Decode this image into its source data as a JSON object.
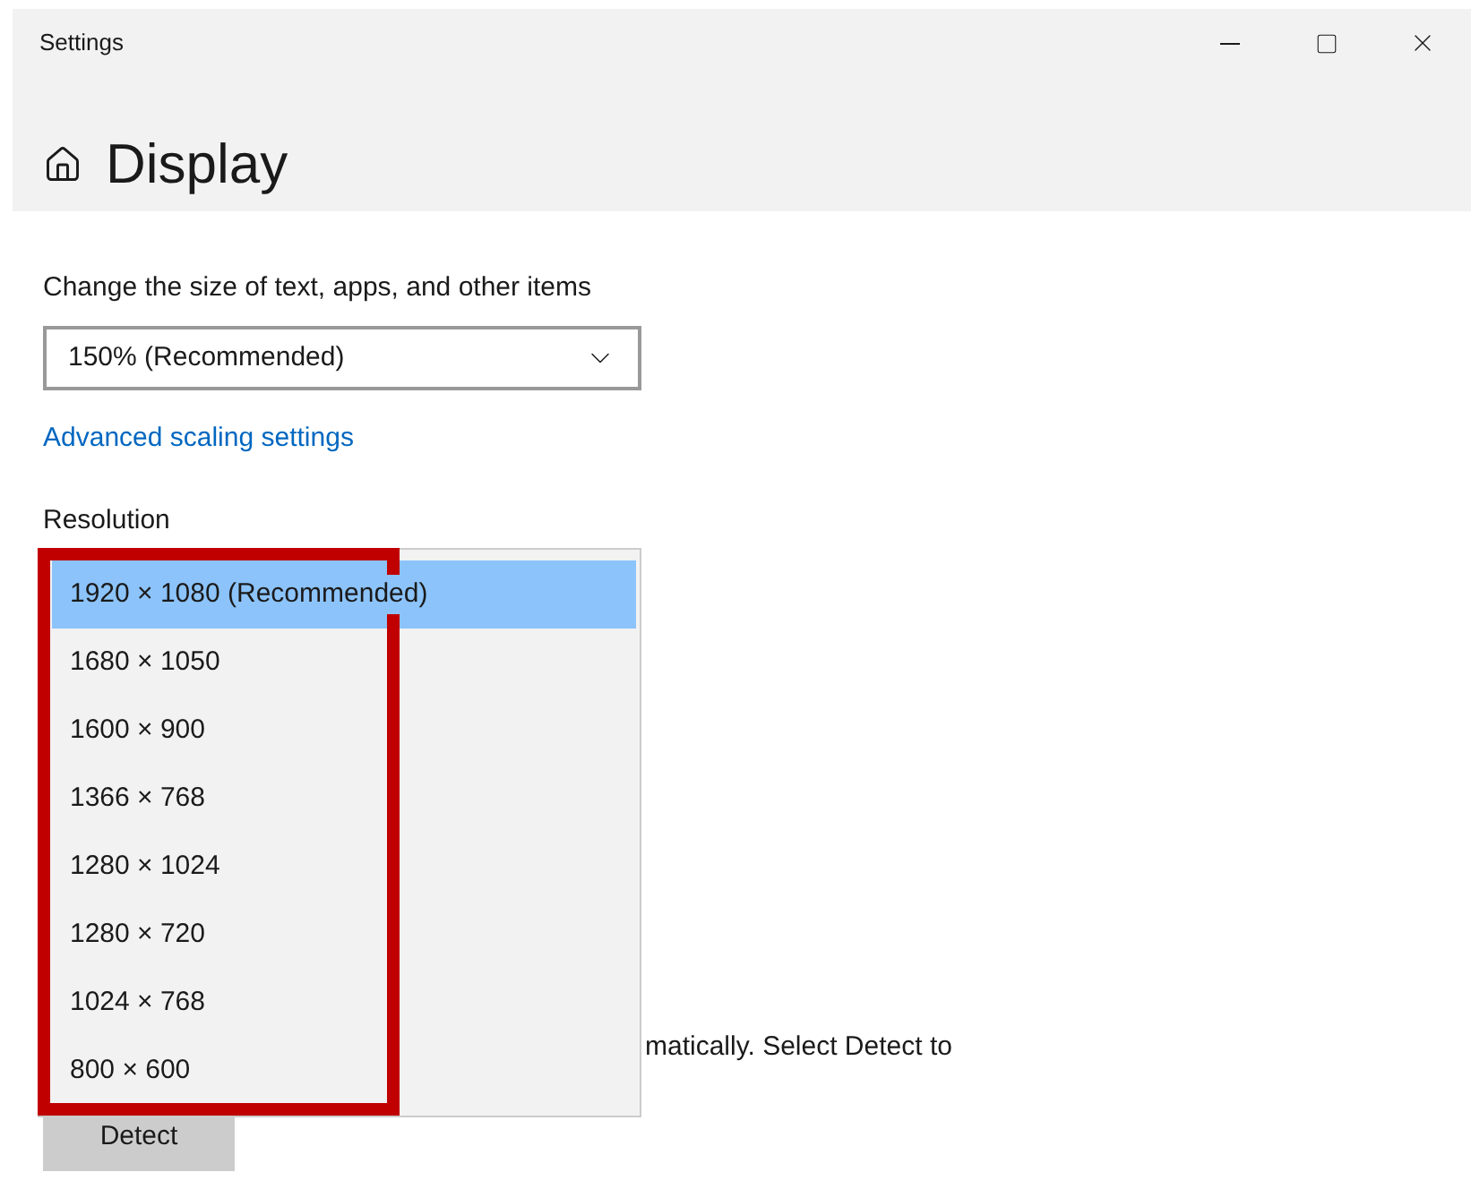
{
  "window": {
    "title": "Settings"
  },
  "page": {
    "title": "Display"
  },
  "scale": {
    "label": "Change the size of text, apps, and other items",
    "value": "150% (Recommended)"
  },
  "advanced_link": "Advanced scaling settings",
  "resolution": {
    "label": "Resolution",
    "options": [
      {
        "label": "1920 × 1080 (Recommended)",
        "selected": true
      },
      {
        "label": "1680 × 1050",
        "selected": false
      },
      {
        "label": "1600 × 900",
        "selected": false
      },
      {
        "label": "1366 × 768",
        "selected": false
      },
      {
        "label": "1280 × 1024",
        "selected": false
      },
      {
        "label": "1280 × 720",
        "selected": false
      },
      {
        "label": "1024 × 768",
        "selected": false
      },
      {
        "label": "800 × 600",
        "selected": false
      }
    ]
  },
  "detect_text": "matically. Select Detect to",
  "detect_button": "Detect"
}
